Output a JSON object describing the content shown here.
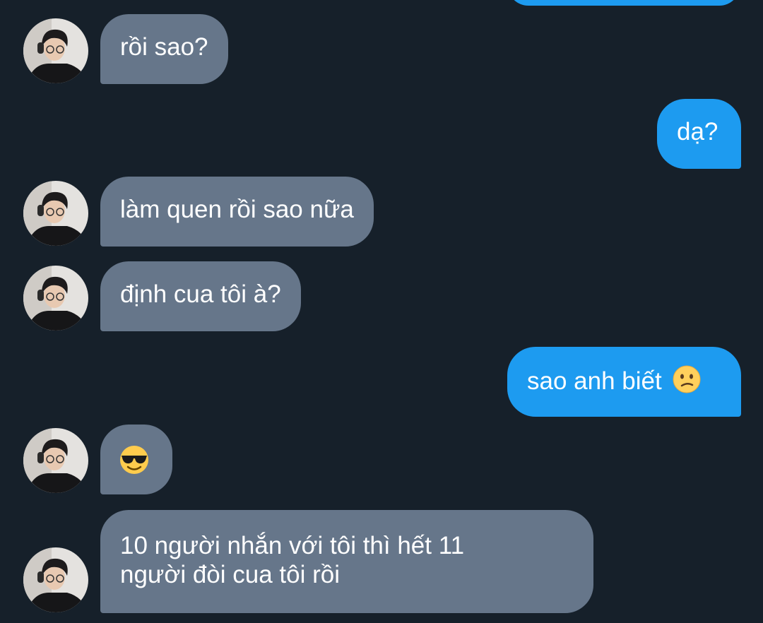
{
  "conversation": {
    "messages": [
      {
        "direction": "received",
        "text": "rồi sao?"
      },
      {
        "direction": "sent",
        "text": "dạ?"
      },
      {
        "direction": "received",
        "text": "làm quen rồi sao nữa"
      },
      {
        "direction": "received",
        "text": "định cua tôi à?"
      },
      {
        "direction": "sent",
        "text": "sao anh biết",
        "emoji": "confused-face-icon"
      },
      {
        "direction": "received",
        "text": "",
        "emoji": "sunglasses-face-icon"
      },
      {
        "direction": "received",
        "line1": "10 người nhắn với tôi thì hết 11",
        "line2": "người đòi cua tôi rồi"
      }
    ]
  },
  "colors": {
    "background": "#16202a",
    "received_bubble": "#66768a",
    "sent_bubble": "#1d9bf0",
    "text": "#ffffff"
  }
}
